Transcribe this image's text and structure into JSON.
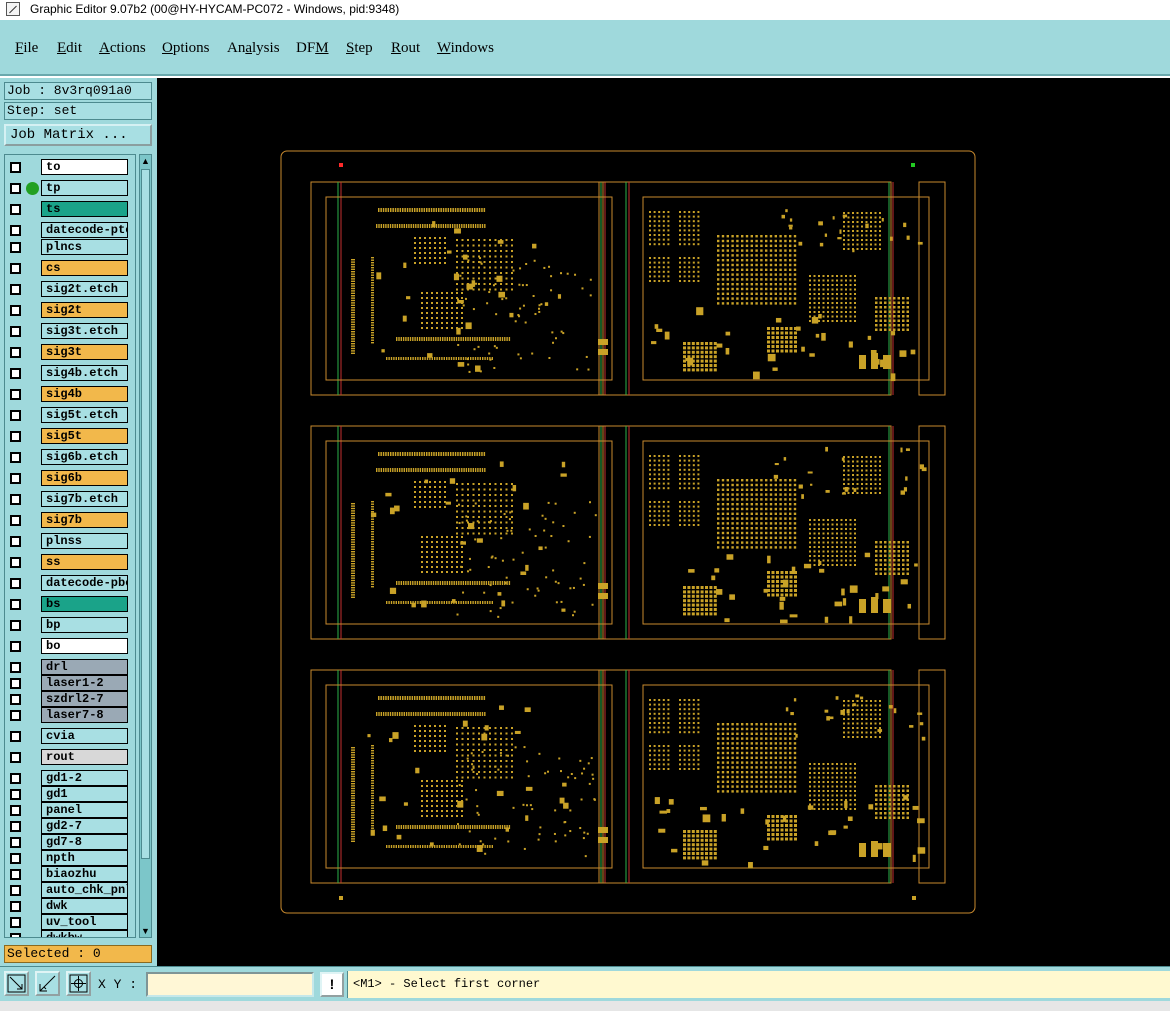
{
  "window": {
    "title": "Graphic Editor 9.07b2 (00@HY-HYCAM-PC072 - Windows, pid:9348)"
  },
  "menu": [
    {
      "pre": "",
      "u": "F",
      "post": "ile"
    },
    {
      "pre": "",
      "u": "E",
      "post": "dit"
    },
    {
      "pre": "",
      "u": "A",
      "post": "ctions"
    },
    {
      "pre": "",
      "u": "O",
      "post": "ptions"
    },
    {
      "pre": "An",
      "u": "a",
      "post": "lysis"
    },
    {
      "pre": "DF",
      "u": "M",
      "post": ""
    },
    {
      "pre": "",
      "u": "S",
      "post": "tep"
    },
    {
      "pre": "",
      "u": "R",
      "post": "out"
    },
    {
      "pre": "",
      "u": "W",
      "post": "indows"
    }
  ],
  "job": {
    "label": "Job : 8v3rq091a0",
    "step_label": "Step: set",
    "matrix_button": "Job Matrix ..."
  },
  "layers": [
    {
      "name": "to",
      "color": "#ffffff"
    },
    {
      "name": "tp",
      "color": "#a8dfe3",
      "dot": true
    },
    {
      "name": "ts",
      "color": "#1aa389"
    },
    {
      "name": "datecode-ptc",
      "color": "#a8dfe3"
    },
    {
      "name": "plncs",
      "color": "#a8dfe3"
    },
    {
      "name": "cs",
      "color": "#f2b84b"
    },
    {
      "name": "sig2t.etch",
      "color": "#a8dfe3"
    },
    {
      "name": "sig2t",
      "color": "#f2b84b"
    },
    {
      "name": "sig3t.etch",
      "color": "#a8dfe3"
    },
    {
      "name": "sig3t",
      "color": "#f2b84b"
    },
    {
      "name": "sig4b.etch",
      "color": "#a8dfe3"
    },
    {
      "name": "sig4b",
      "color": "#f2b84b"
    },
    {
      "name": "sig5t.etch",
      "color": "#a8dfe3"
    },
    {
      "name": "sig5t",
      "color": "#f2b84b"
    },
    {
      "name": "sig6b.etch",
      "color": "#a8dfe3"
    },
    {
      "name": "sig6b",
      "color": "#f2b84b"
    },
    {
      "name": "sig7b.etch",
      "color": "#a8dfe3"
    },
    {
      "name": "sig7b",
      "color": "#f2b84b"
    },
    {
      "name": "plnss",
      "color": "#a8dfe3"
    },
    {
      "name": "ss",
      "color": "#f2b84b"
    },
    {
      "name": "datecode-pbe",
      "color": "#a8dfe3"
    },
    {
      "name": "bs",
      "color": "#1aa389"
    },
    {
      "name": "bp",
      "color": "#a8dfe3"
    },
    {
      "name": "bo",
      "color": "#ffffff"
    },
    {
      "name": "drl",
      "color": "#9aa9b5"
    },
    {
      "name": "laser1-2",
      "color": "#9aa9b5"
    },
    {
      "name": "szdrl2-7",
      "color": "#9aa9b5"
    },
    {
      "name": "laser7-8",
      "color": "#9aa9b5"
    },
    {
      "name": "cvia",
      "color": "#a8dfe3"
    },
    {
      "name": "rout",
      "color": "#d8d8d8"
    },
    {
      "name": "gd1-2",
      "color": "#a8dfe3"
    },
    {
      "name": "gd1",
      "color": "#a8dfe3"
    },
    {
      "name": "panel",
      "color": "#a8dfe3"
    },
    {
      "name": "gd2-7",
      "color": "#a8dfe3"
    },
    {
      "name": "gd7-8",
      "color": "#a8dfe3"
    },
    {
      "name": "npth",
      "color": "#a8dfe3"
    },
    {
      "name": "biaozhu",
      "color": "#a8dfe3"
    },
    {
      "name": "auto_chk_pnl",
      "color": "#a8dfe3"
    },
    {
      "name": "dwk",
      "color": "#a8dfe3"
    },
    {
      "name": "uv_tool",
      "color": "#a8dfe3"
    },
    {
      "name": "dwkbw",
      "color": "#a8dfe3"
    }
  ],
  "selected": "Selected : 0",
  "bottom": {
    "xy_label": "X Y :",
    "xy_value": "",
    "alert": "!",
    "status": "<M1> - Select first corner"
  },
  "colors": {
    "panel_bg": "#9fd9dc",
    "canvas_bg": "#000000",
    "copper": "#c9a227",
    "outline": "#c98a2e"
  }
}
